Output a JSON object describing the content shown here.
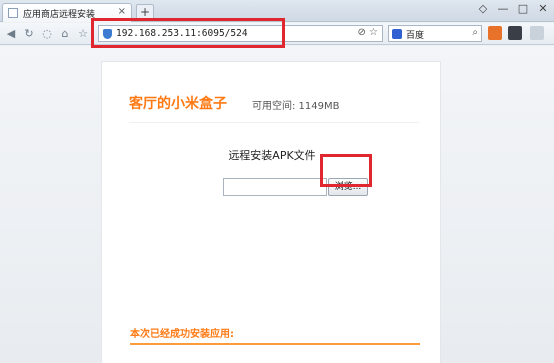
{
  "tabs": [
    {
      "title": "应用商店远程安装",
      "close": "×"
    }
  ],
  "new_tab_label": "+",
  "window_controls": [
    "◇",
    "—",
    "□",
    "✕"
  ],
  "toolbar": {
    "url": "192.168.253.11:6095/524",
    "search_engine": "百度",
    "nav_icons": [
      "back-icon",
      "refresh-icon",
      "stop-icon",
      "home-icon",
      "star-icon"
    ]
  },
  "page": {
    "brand": "客厅的小米盒子",
    "storage": "可用空间: 1149MB",
    "upload_title": "远程安装APK文件",
    "browse_label": "浏览...",
    "success_message": "本次已经成功安装应用:"
  },
  "colors": {
    "accent": "#ff7a14",
    "highlight": "#e0262f"
  }
}
